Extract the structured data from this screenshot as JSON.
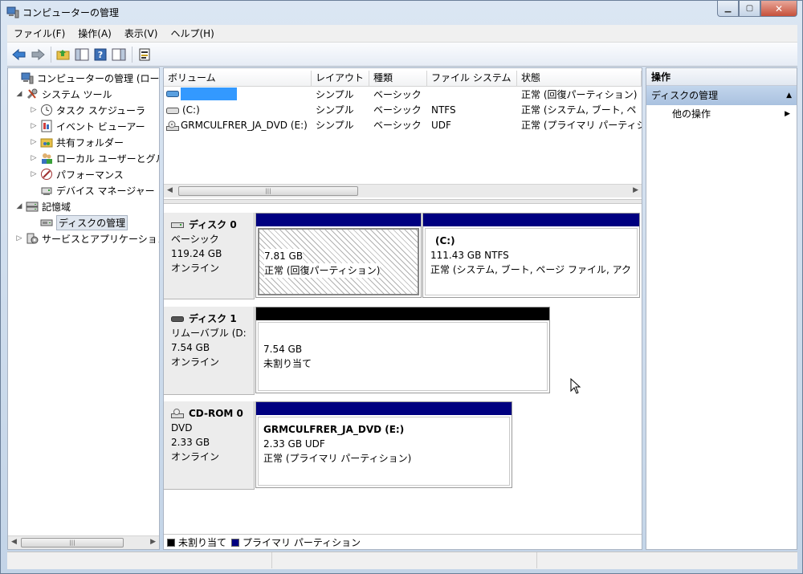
{
  "window": {
    "title": "コンピューターの管理",
    "icon": "computer-management-icon"
  },
  "menu": [
    {
      "label": "ファイル(F)"
    },
    {
      "label": "操作(A)"
    },
    {
      "label": "表示(V)"
    },
    {
      "label": "ヘルプ(H)"
    }
  ],
  "tree": [
    {
      "label": "コンピューターの管理 (ローカル)",
      "icon": "computer-management-icon",
      "expander": "",
      "level": 0
    },
    {
      "label": "システム ツール",
      "icon": "tools-icon",
      "expander": "◢",
      "level": 1
    },
    {
      "label": "タスク スケジューラ",
      "icon": "clock-icon",
      "expander": "▷",
      "level": 2
    },
    {
      "label": "イベント ビューアー",
      "icon": "event-viewer-icon",
      "expander": "▷",
      "level": 2
    },
    {
      "label": "共有フォルダー",
      "icon": "shared-folder-icon",
      "expander": "▷",
      "level": 2
    },
    {
      "label": "ローカル ユーザーとグループ",
      "icon": "users-icon",
      "expander": "▷",
      "level": 2
    },
    {
      "label": "パフォーマンス",
      "icon": "performance-icon",
      "expander": "▷",
      "level": 2
    },
    {
      "label": "デバイス マネージャー",
      "icon": "device-manager-icon",
      "expander": "",
      "level": 2
    },
    {
      "label": "記憶域",
      "icon": "storage-icon",
      "expander": "◢",
      "level": 1
    },
    {
      "label": "ディスクの管理",
      "icon": "disk-management-icon",
      "expander": "",
      "level": 2,
      "selected": true
    },
    {
      "label": "サービスとアプリケーション",
      "icon": "services-icon",
      "expander": "▷",
      "level": 1
    }
  ],
  "volume_table": {
    "columns": [
      "ボリューム",
      "レイアウト",
      "種類",
      "ファイル システム",
      "状態"
    ],
    "rows": [
      {
        "volume": "",
        "layout": "シンプル",
        "type": "ベーシック",
        "fs": "",
        "status": "正常 (回復パーティション)"
      },
      {
        "volume": "(C:)",
        "layout": "シンプル",
        "type": "ベーシック",
        "fs": "NTFS",
        "status": "正常 (システム, ブート, ペ"
      },
      {
        "volume": "GRMCULFRER_JA_DVD (E:)",
        "layout": "シンプル",
        "type": "ベーシック",
        "fs": "UDF",
        "status": "正常 (プライマリ パーティシ"
      }
    ]
  },
  "disks": [
    {
      "name": "ディスク 0",
      "type": "ベーシック",
      "size": "119.24 GB",
      "state": "オンライン",
      "partitions": [
        {
          "title": "",
          "size": "7.81 GB",
          "status": "正常 (回復パーティション)"
        },
        {
          "title": "(C:)",
          "size": "111.43 GB NTFS",
          "status": "正常 (システム, ブート, ページ ファイル, アク"
        }
      ]
    },
    {
      "name": "ディスク 1",
      "type": "リムーバブル (D:",
      "size": "7.54 GB",
      "state": "オンライン",
      "partitions": [
        {
          "title": "",
          "size": "7.54 GB",
          "status": "未割り当て"
        }
      ]
    },
    {
      "name": "CD-ROM 0",
      "type": "DVD",
      "size": "2.33 GB",
      "state": "オンライン",
      "partitions": [
        {
          "title": "GRMCULFRER_JA_DVD  (E:)",
          "size": "2.33 GB UDF",
          "status": "正常 (プライマリ パーティション)"
        }
      ]
    }
  ],
  "legend": [
    {
      "label": "未割り当て",
      "color": "#000000"
    },
    {
      "label": "プライマリ パーティション",
      "color": "#000080"
    }
  ],
  "actions": {
    "header": "操作",
    "group": "ディスクの管理",
    "items": [
      {
        "label": "他の操作"
      }
    ]
  },
  "colors": {
    "primary_partition": "#000080",
    "unallocated": "#000000",
    "selection": "#3399ff"
  }
}
